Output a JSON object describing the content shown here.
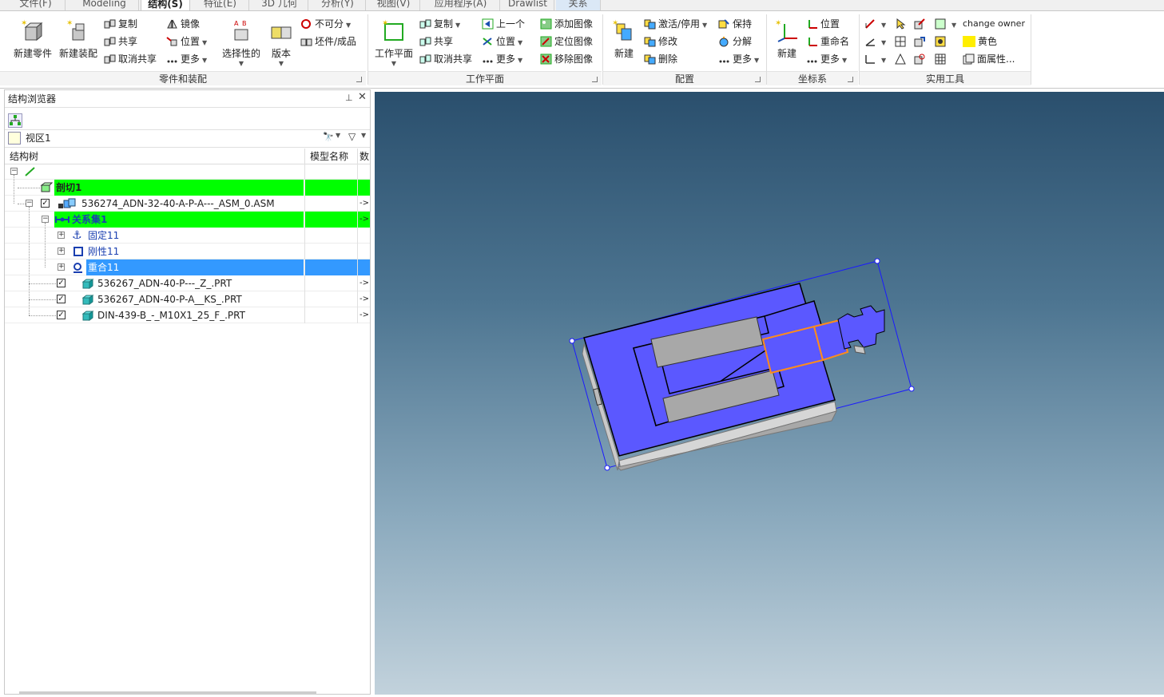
{
  "tabs": [
    "文件(F)",
    "Modeling",
    "结构(S)",
    "特征(E)",
    "3D 几何",
    "分析(Y)",
    "视图(V)",
    "应用程序(A)",
    "Drawlist",
    "关系"
  ],
  "active_tab": "结构(S)",
  "ribbon": {
    "groups": {
      "parts": "零件和装配",
      "workplane": "工作平面",
      "config": "配置",
      "coord": "坐标系",
      "utility": "实用工具"
    },
    "parts": {
      "new_part": "新建零件",
      "new_assembly": "新建装配",
      "copy": "复制",
      "share": "共享",
      "unshare": "取消共享",
      "mirror": "镜像",
      "position": "位置",
      "more": "更多",
      "selective": "选择性的",
      "version": "版本",
      "not_available": "不可分",
      "blank_finished": "坯件/成品"
    },
    "workplane": {
      "workplane": "工作平面",
      "copy": "复制",
      "share": "共享",
      "unshare": "取消共享",
      "prev": "上一个",
      "position": "位置",
      "more": "更多",
      "add_image": "添加图像",
      "locate_image": "定位图像",
      "remove_image": "移除图像"
    },
    "config": {
      "new": "新建",
      "activate": "激活/停用",
      "modify": "修改",
      "delete": "删除",
      "keep": "保持",
      "explode": "分解",
      "more": "更多"
    },
    "coord": {
      "new": "新建",
      "position": "位置",
      "rename": "重命名",
      "more": "更多"
    },
    "utility": {
      "change_owner": "change owner",
      "color_yellow": "黄色",
      "face_props": "面属性..."
    }
  },
  "browser": {
    "title": "结构浏览器",
    "view": "视区1",
    "col_tree": "结构树",
    "col_model": "模型名称",
    "col_num": "数",
    "rows": [
      {
        "label": "剖切1",
        "arrow": ""
      },
      {
        "label": "536274_ADN-32-40-A-P-A---_ASM_0.ASM",
        "arrow": "->"
      },
      {
        "label": "关系集1",
        "arrow": "->"
      },
      {
        "label": "固定11",
        "arrow": ""
      },
      {
        "label": "刚性11",
        "arrow": ""
      },
      {
        "label": "重合11",
        "arrow": ""
      },
      {
        "label": "536267_ADN-40-P---_Z_.PRT",
        "arrow": "->"
      },
      {
        "label": "536267_ADN-40-P-A__KS_.PRT",
        "arrow": "->"
      },
      {
        "label": "DIN-439-B_-_M10X1_25_F_.PRT",
        "arrow": "->"
      }
    ]
  },
  "colors": {
    "highlight_green": "#00ff00",
    "selection_blue": "#3399ff",
    "face_blue": "#5b58ff",
    "edge_orange": "#ff8c1a"
  }
}
